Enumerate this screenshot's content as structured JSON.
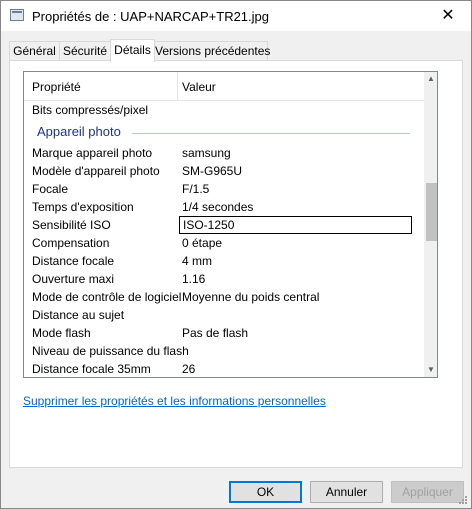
{
  "window": {
    "title": "Propriétés de : UAP+NARCAP+TR21.jpg",
    "close_glyph": "✕"
  },
  "tabs": [
    {
      "label": "Général"
    },
    {
      "label": "Sécurité"
    },
    {
      "label": "Détails"
    },
    {
      "label": "Versions précédentes"
    }
  ],
  "list": {
    "header": {
      "property": "Propriété",
      "value": "Valeur"
    },
    "pre_rows": [
      {
        "key": "Bits compressés/pixel",
        "value": ""
      }
    ],
    "group": "Appareil photo",
    "rows": [
      {
        "key": "Marque appareil photo",
        "value": "samsung"
      },
      {
        "key": "Modèle d'appareil photo",
        "value": "SM-G965U"
      },
      {
        "key": "Focale",
        "value": "F/1.5"
      },
      {
        "key": "Temps d'exposition",
        "value": "1/4 secondes"
      },
      {
        "key": "Sensibilité ISO",
        "value": "ISO-1250",
        "editing": true
      },
      {
        "key": "Compensation",
        "value": "0 étape"
      },
      {
        "key": "Distance focale",
        "value": "4 mm"
      },
      {
        "key": "Ouverture maxi",
        "value": "1.16"
      },
      {
        "key": "Mode de contrôle de logiciel",
        "value": "Moyenne du poids central"
      },
      {
        "key": "Distance au sujet",
        "value": ""
      },
      {
        "key": "Mode flash",
        "value": "Pas de flash"
      },
      {
        "key": "Niveau de puissance du flash",
        "value": ""
      },
      {
        "key": "Distance focale 35mm",
        "value": "26"
      }
    ]
  },
  "link": "Supprimer les propriétés et les informations personnelles",
  "buttons": {
    "ok": "OK",
    "cancel": "Annuler",
    "apply": "Appliquer"
  },
  "colors": {
    "group_heading": "#1e3287",
    "link": "#0066cc",
    "ok_border": "#0078d7"
  },
  "icons": {
    "scroll_up": "▲",
    "scroll_down": "▼"
  }
}
